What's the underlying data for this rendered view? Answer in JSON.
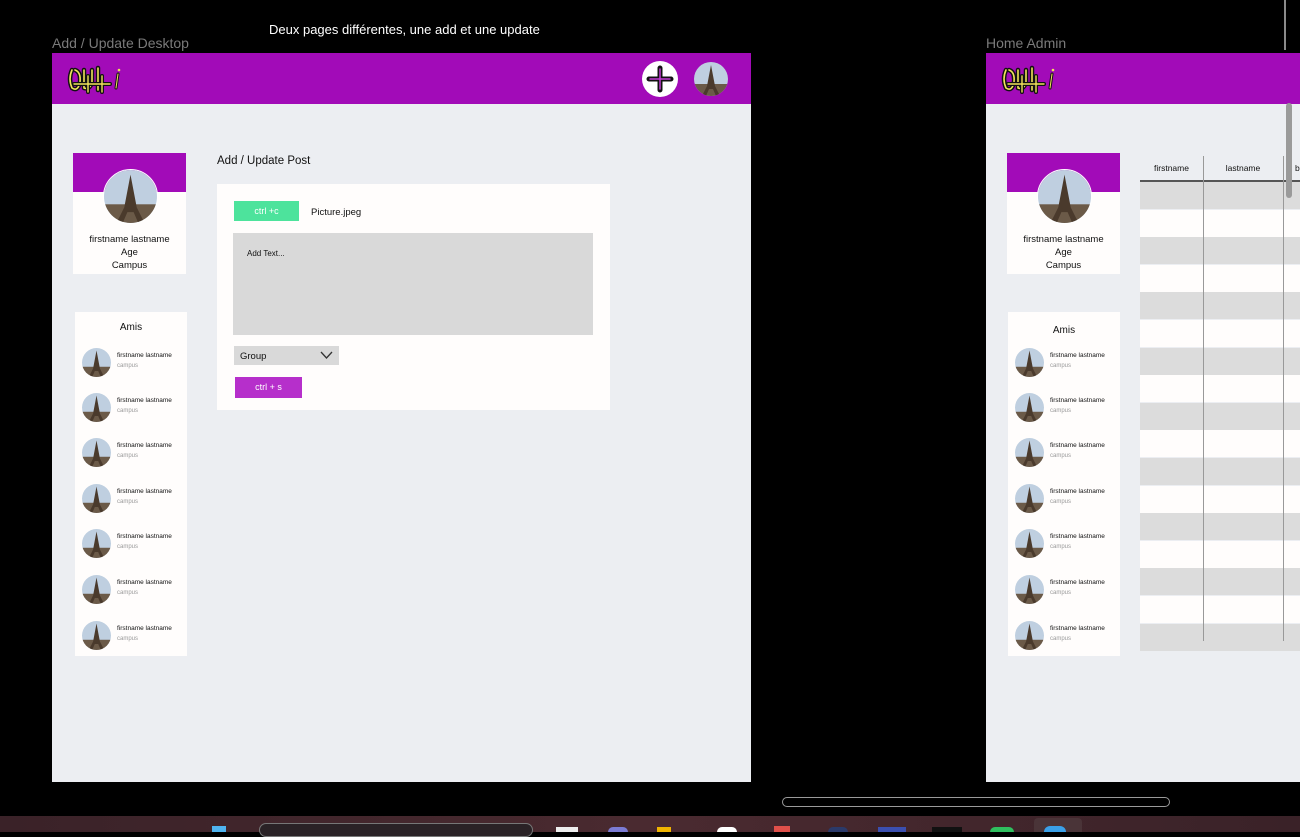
{
  "canvas": {
    "note": "Deux pages différentes, une add et une update"
  },
  "frames": {
    "left": {
      "label": "Add / Update Desktop",
      "header": {
        "logo": "logo-icon",
        "add_button": "plus-icon",
        "avatar": "eiffel-avatar"
      },
      "profile": {
        "name": "firstname lastname",
        "age": "Age",
        "campus": "Campus"
      },
      "friends": {
        "title": "Amis",
        "items": [
          {
            "name": "firstname lastname",
            "campus": "campus"
          },
          {
            "name": "firstname lastname",
            "campus": "campus"
          },
          {
            "name": "firstname lastname",
            "campus": "campus"
          },
          {
            "name": "firstname lastname",
            "campus": "campus"
          },
          {
            "name": "firstname lastname",
            "campus": "campus"
          },
          {
            "name": "firstname lastname",
            "campus": "campus"
          },
          {
            "name": "firstname lastname",
            "campus": "campus"
          }
        ]
      },
      "form": {
        "title": "Add / Update Post",
        "paste_button": "ctrl +c",
        "file_name": "Picture.jpeg",
        "text_placeholder": "Add Text...",
        "group_select": "Group",
        "save_button": "ctrl + s"
      }
    },
    "right": {
      "label": "Home Admin",
      "profile": {
        "name": "firstname lastname",
        "age": "Age",
        "campus": "Campus"
      },
      "friends": {
        "title": "Amis",
        "items": [
          {
            "name": "firstname lastname",
            "campus": "campus"
          },
          {
            "name": "firstname lastname",
            "campus": "campus"
          },
          {
            "name": "firstname lastname",
            "campus": "campus"
          },
          {
            "name": "firstname lastname",
            "campus": "campus"
          },
          {
            "name": "firstname lastname",
            "campus": "campus"
          },
          {
            "name": "firstname lastname",
            "campus": "campus"
          },
          {
            "name": "firstname lastname",
            "campus": "campus"
          }
        ]
      },
      "table": {
        "columns": [
          "firstname",
          "lastname",
          "b"
        ]
      }
    }
  },
  "colors": {
    "brand_purple": "#a20bb8",
    "button_purple": "#b62fcb",
    "button_green": "#4de39c",
    "frame_bg": "#eceef2"
  }
}
